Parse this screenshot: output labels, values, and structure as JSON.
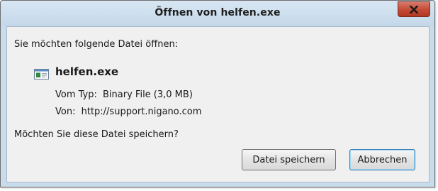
{
  "dialog": {
    "title": "Öffnen von helfen.exe",
    "prompt": "Sie möchten folgende Datei öffnen:",
    "file": {
      "name": "helfen.exe",
      "icon": "executable-file-icon",
      "type_label": "Vom Typ:",
      "type_value": "Binary File (3,0 MB)",
      "source_label": "Von:",
      "source_value": "http://support.nigano.com"
    },
    "question": "Möchten Sie diese Datei speichern?",
    "buttons": {
      "save": "Datei speichern",
      "cancel": "Abbrechen"
    },
    "close_icon": "close-icon",
    "colors": {
      "title_bar": "#c9dcec",
      "close_button": "#c34a36",
      "content_background": "#f0f0f0",
      "focused_button_border": "#3c7fb1"
    }
  }
}
